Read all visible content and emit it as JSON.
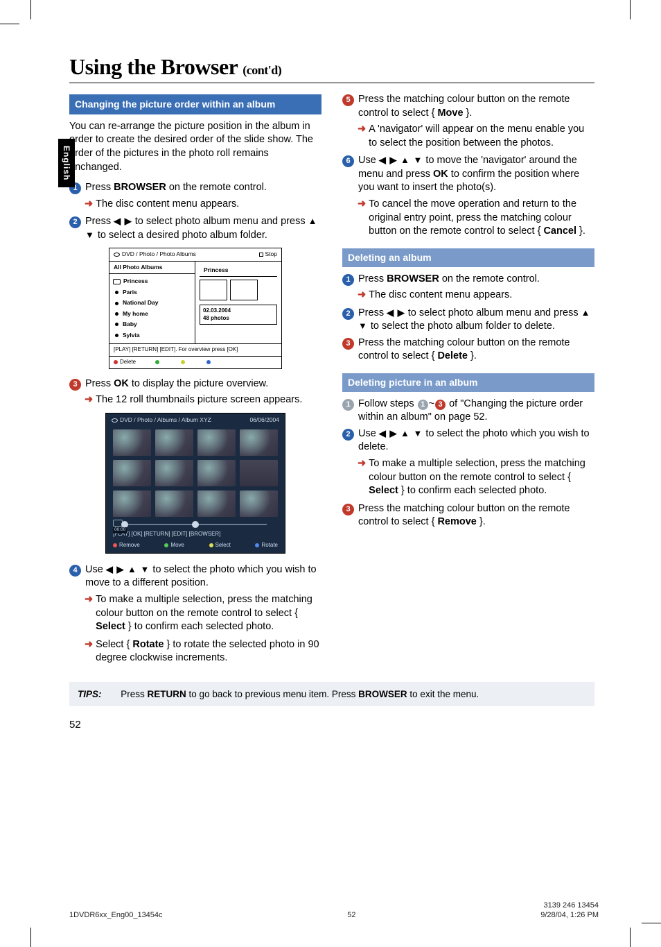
{
  "sidetab": "English",
  "title_main": "Using the Browser",
  "title_contd": "(cont'd)",
  "left": {
    "section_header": "Changing the picture order within an album",
    "intro": "You can re-arrange the picture position in the album in order to create the desired order of the slide show.  The order of the pictures in the photo roll remains unchanged.",
    "s1a": "Press ",
    "s1b": "BROWSER",
    "s1c": " on the remote control.",
    "s1_out": "The disc content menu appears.",
    "s2a": "Press ",
    "s2_arrows_lr": "◀ ▶",
    "s2b": " to select photo album menu and press ",
    "s2_arrows_ud": "▲ ▼",
    "s2c": " to select a desired photo album folder.",
    "s3a": "Press ",
    "s3b": "OK",
    "s3c": " to display the picture overview.",
    "s3_out": "The 12 roll thumbnails picture screen appears.",
    "s4a": "Use ",
    "s4_arrows": "◀ ▶ ▲ ▼",
    "s4b": " to select the photo which you wish to move to a different position.",
    "s4_out1a": "To make a multiple selection, press the matching colour button on the remote control to select { ",
    "s4_out1b": "Select",
    "s4_out1c": " } to confirm each selected photo.",
    "s4_out2a": "Select { ",
    "s4_out2b": "Rotate",
    "s4_out2c": " } to rotate the selected photo in 90 degree clockwise increments."
  },
  "right": {
    "s5a": "Press the matching colour button on the remote control to select { ",
    "s5b": "Move",
    "s5c": " }.",
    "s5_out": "A 'navigator' will appear on the menu enable you to select the position between the photos.",
    "s6a": "Use ",
    "s6_arrows": "◀ ▶ ▲ ▼",
    "s6b": " to move the 'navigator' around the menu and press ",
    "s6c": "OK",
    "s6d": " to confirm the position where you want to insert the photo(s).",
    "s6_out_a": "To cancel the move operation and return to the original entry point, press the matching colour button on the remote control to select { ",
    "s6_out_b": "Cancel",
    "s6_out_c": " }.",
    "del_album_header": "Deleting an album",
    "da1a": "Press ",
    "da1b": "BROWSER",
    "da1c": " on the remote control.",
    "da1_out": "The disc content menu appears.",
    "da2a": "Press ",
    "da2_lr": "◀ ▶",
    "da2b": " to select photo album menu and press ",
    "da2_ud": "▲ ▼",
    "da2c": " to select the photo album folder to delete.",
    "da3a": "Press the matching colour button on the remote control to select { ",
    "da3b": "Delete",
    "da3c": " }.",
    "del_pic_header": "Deleting picture in an album",
    "dp1a": "Follow steps ",
    "dp1b": " of \"Changing the picture order within an album\" on page 52.",
    "dp2a": "Use ",
    "dp2_arrows": "◀ ▶ ▲ ▼",
    "dp2b": " to select the photo which you wish to delete.",
    "dp2_out_a": "To make a multiple selection, press the matching colour button on the remote control to select { ",
    "dp2_out_b": "Select",
    "dp2_out_c": " } to confirm each selected photo.",
    "dp3a": "Press the matching colour button on the remote control to select { ",
    "dp3b": "Remove",
    "dp3c": " }."
  },
  "fig1": {
    "top_path": "DVD / Photo / Photo Albums",
    "top_stop": "Stop",
    "left_head": "All Photo Albums",
    "right_head": "Princess",
    "items": [
      "Princess",
      "Paris",
      "National Day",
      "My home",
      "Baby",
      "Sylvia"
    ],
    "date": "02.03.2004",
    "count": "48 photos",
    "hints": "[PLAY] [RETURN] [EDIT].  For overview press [OK]",
    "color_red": "Delete"
  },
  "fig2": {
    "top_path": "DVD / Photo / Albums / Album XYZ",
    "top_date": "06/06/2004",
    "alb_label": "ALB.",
    "time": "00:00",
    "hints": "[PLAY] [OK] [RETURN] [EDIT] [BROWSER]",
    "btn_red": "Remove",
    "btn_green": "Move",
    "btn_yellow": "Select",
    "btn_blue": "Rotate"
  },
  "tips": {
    "label": "TIPS:",
    "text_a": "Press ",
    "text_b": "RETURN",
    "text_c": " to go back to previous menu item.  Press ",
    "text_d": "BROWSER",
    "text_e": " to exit the menu."
  },
  "pagenum": "52",
  "footer": {
    "left": "1DVDR6xx_Eng00_13454c",
    "mid": "52",
    "right1": "9/28/04, 1:26 PM",
    "right2": "3139 246 13454"
  }
}
